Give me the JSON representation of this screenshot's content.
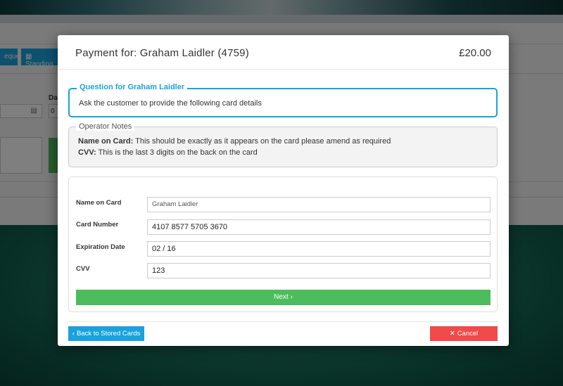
{
  "background": {
    "cheque_label": "eque",
    "standing_label": "Standing",
    "date_label": "Da",
    "date_value": "0"
  },
  "modal": {
    "title": "Payment for: Graham Laidler (4759)",
    "amount": "£20.00"
  },
  "question": {
    "legend": "Question for Graham Laidler",
    "text": "Ask the customer to provide the following card details"
  },
  "notes": {
    "legend": "Operator Notes",
    "lines": [
      {
        "label": "Name on Card:",
        "text": " This should be exactly as it appears on the card please amend as required"
      },
      {
        "label": "CVV:",
        "text": " This is the last 3 digits on the back on the card"
      }
    ]
  },
  "form": {
    "fields": [
      {
        "label": "Name on Card",
        "value": "Graham Laidler"
      },
      {
        "label": "Card Number",
        "value": "4107 8577 5705 3670"
      },
      {
        "label": "Expiration Date",
        "value": "02 / 16"
      },
      {
        "label": "CVV",
        "value": "123"
      }
    ],
    "next_label": "Next",
    "next_icon": "chevron-right-icon"
  },
  "footer": {
    "back_label": "Back to Stored Cards",
    "back_icon": "chevron-left-icon",
    "cancel_label": "Cancel",
    "cancel_icon": "close-icon"
  },
  "colors": {
    "primary": "#1aa2dc",
    "success": "#4cbc5c",
    "danger": "#f04a4a"
  }
}
